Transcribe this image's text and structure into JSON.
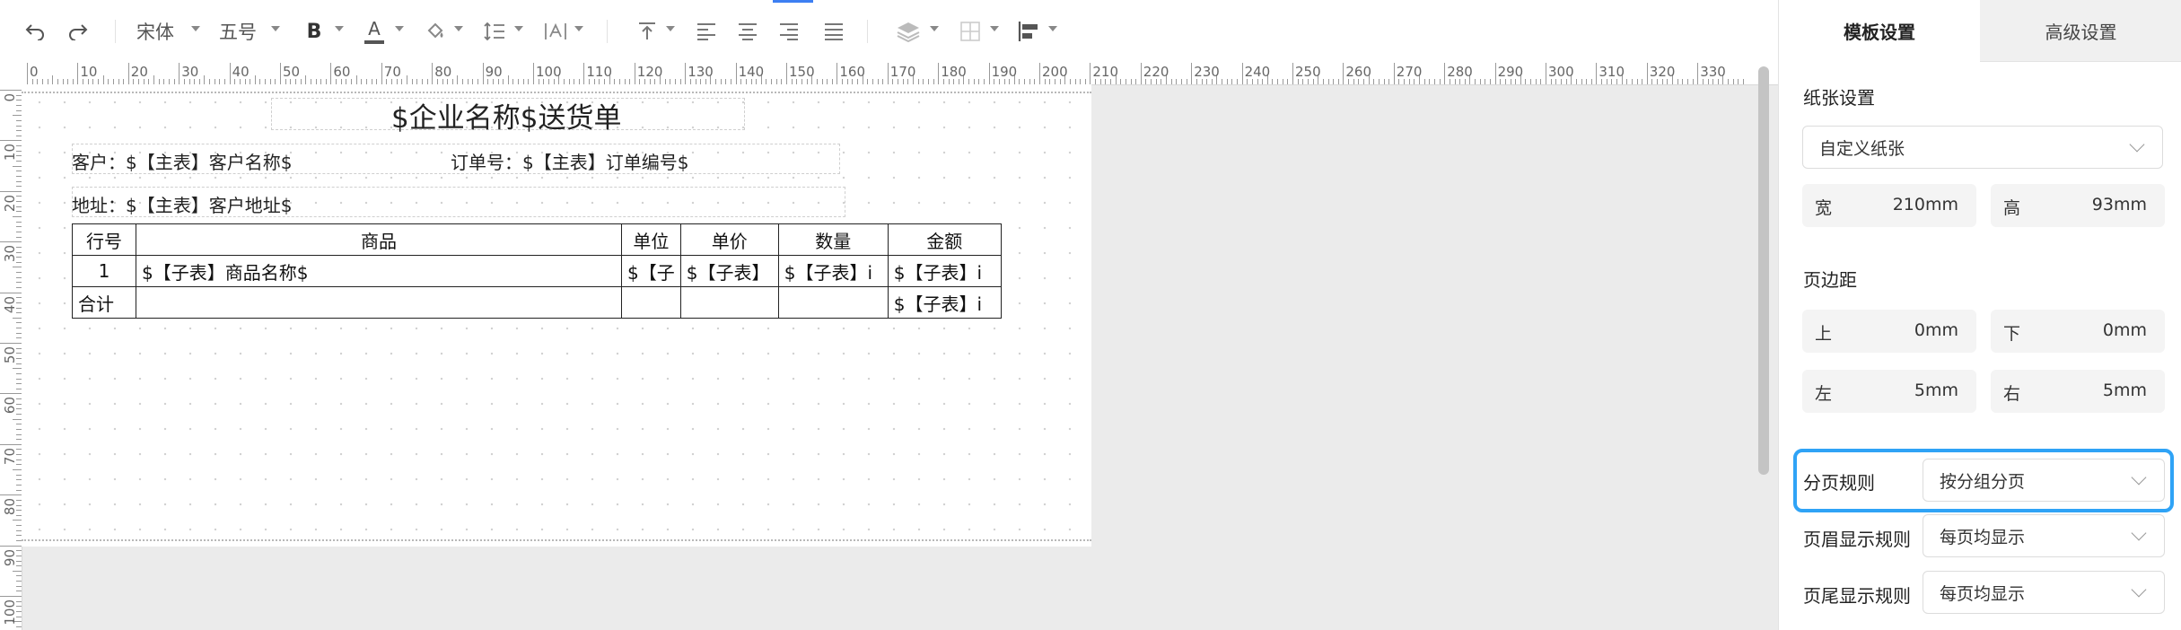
{
  "toolbar": {
    "font_family": "宋体",
    "font_size": "五号",
    "bold_icon": "B",
    "font_color_icon": "A",
    "accent_color": "#3d7ff2"
  },
  "ruler": {
    "h_labels": [
      "0",
      "10",
      "20",
      "30",
      "40",
      "50",
      "60",
      "70",
      "80",
      "90",
      "100",
      "110",
      "120",
      "130",
      "140",
      "150",
      "160",
      "170",
      "180",
      "190",
      "200",
      "210",
      "220",
      "230",
      "240",
      "250",
      "260",
      "270",
      "280",
      "290",
      "300",
      "310",
      "320",
      "330"
    ],
    "v_labels": [
      "0",
      "10",
      "20",
      "30",
      "40",
      "50",
      "60",
      "70",
      "80",
      "90",
      "100"
    ]
  },
  "paper": {
    "title": "$企业名称$送货单",
    "customer": "客户：$【主表】客户名称$",
    "order_no": "订单号：$【主表】订单编号$",
    "address": "地址：$【主表】客户地址$",
    "table": {
      "headers": [
        "行号",
        "商品",
        "单位",
        "单价",
        "数量",
        "金额"
      ],
      "row1": [
        "1",
        "$【子表】商品名称$",
        "$【子",
        "$【子表】",
        "$【子表】i",
        "$【子表】i"
      ],
      "total": [
        "合计",
        "",
        "",
        "",
        "",
        "$【子表】i"
      ]
    }
  },
  "panel": {
    "tabs": [
      "模板设置",
      "高级设置"
    ],
    "paper_settings_label": "纸张设置",
    "paper_type": "自定义纸张",
    "width_label": "宽",
    "width_value": "210mm",
    "height_label": "高",
    "height_value": "93mm",
    "margin_label": "页边距",
    "margin_top_label": "上",
    "margin_top_value": "0mm",
    "margin_bottom_label": "下",
    "margin_bottom_value": "0mm",
    "margin_left_label": "左",
    "margin_left_value": "5mm",
    "margin_right_label": "右",
    "margin_right_value": "5mm",
    "pagination_label": "分页规则",
    "pagination_value": "按分组分页",
    "header_rule_label": "页眉显示规则",
    "header_rule_value": "每页均显示",
    "footer_rule_label": "页尾显示规则",
    "footer_rule_value": "每页均显示",
    "highlight_color": "#2fa3f6"
  }
}
